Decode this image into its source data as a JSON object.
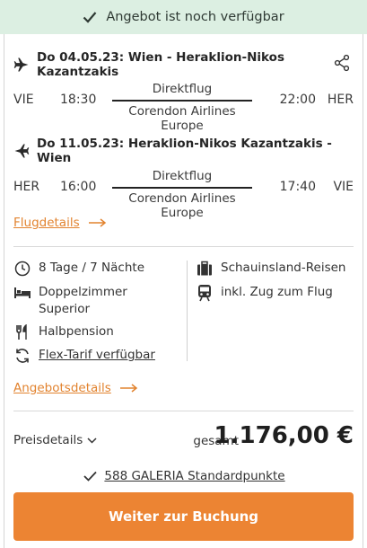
{
  "banner": {
    "text": "Angebot ist noch verfügbar",
    "icon": "check-icon"
  },
  "outbound": {
    "header": "Do 04.05.23: Wien - Heraklion-Nikos Kazantzakis",
    "from_code": "VIE",
    "dep_time": "18:30",
    "type": "Direktflug",
    "airline": "Corendon Airlines Europe",
    "arr_time": "22:00",
    "to_code": "HER"
  },
  "inbound": {
    "header": "Do 11.05.23: Heraklion-Nikos Kazantzakis - Wien",
    "from_code": "HER",
    "dep_time": "16:00",
    "type": "Direktflug",
    "airline": "Corendon Airlines Europe",
    "arr_time": "17:40",
    "to_code": "VIE"
  },
  "flight_details_link": "Flugdetails",
  "features_left": [
    {
      "icon": "clock-icon",
      "text": "8 Tage / 7 Nächte"
    },
    {
      "icon": "bed-icon",
      "text": "Doppelzimmer Superior"
    },
    {
      "icon": "cutlery-icon",
      "text": "Halbpension"
    },
    {
      "icon": "refresh-icon",
      "text": "Flex-Tarif verfügbar"
    }
  ],
  "features_right": [
    {
      "icon": "suitcase-icon",
      "text": "Schauinsland-Reisen"
    },
    {
      "icon": "train-icon",
      "text": "inkl. Zug zum Flug"
    }
  ],
  "offer_details_link": "Angebotsdetails",
  "price": {
    "details_label": "Preisdetails",
    "total_label": "gesamt",
    "amount": "1.176,00 €"
  },
  "points": {
    "text": "588 GALERIA Standardpunkte"
  },
  "cta": {
    "label": "Weiter zur Buchung"
  },
  "colors": {
    "accent": "#ec8433",
    "link": "#e2832f",
    "banner_bg": "#dcefe2"
  }
}
